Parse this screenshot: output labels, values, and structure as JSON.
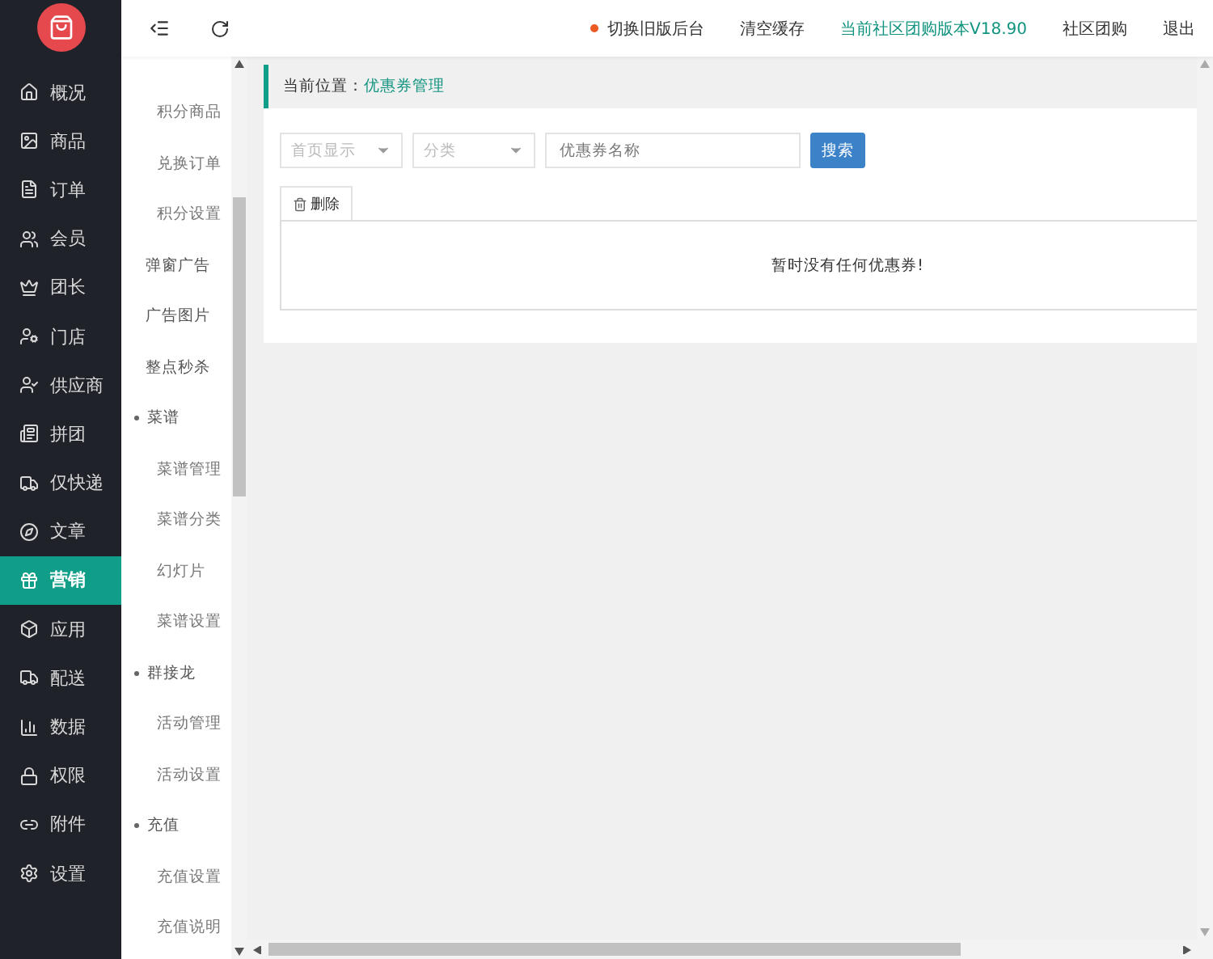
{
  "sidebar": {
    "items": [
      {
        "label": "概况",
        "selected": false
      },
      {
        "label": "商品",
        "selected": false
      },
      {
        "label": "订单",
        "selected": false
      },
      {
        "label": "会员",
        "selected": false
      },
      {
        "label": "团长",
        "selected": false
      },
      {
        "label": "门店",
        "selected": false
      },
      {
        "label": "供应商",
        "selected": false
      },
      {
        "label": "拼团",
        "selected": false
      },
      {
        "label": "仅快递",
        "selected": false
      },
      {
        "label": "文章",
        "selected": false
      },
      {
        "label": "营销",
        "selected": true
      },
      {
        "label": "应用",
        "selected": false
      },
      {
        "label": "配送",
        "selected": false
      },
      {
        "label": "数据",
        "selected": false
      },
      {
        "label": "权限",
        "selected": false
      },
      {
        "label": "附件",
        "selected": false
      },
      {
        "label": "设置",
        "selected": false
      }
    ]
  },
  "submenu": [
    {
      "children": [
        {
          "label": "积分商品"
        },
        {
          "label": "兑换订单"
        },
        {
          "label": "积分设置"
        }
      ]
    },
    {
      "label": "弹窗广告"
    },
    {
      "label": "广告图片"
    },
    {
      "label": "整点秒杀"
    },
    {
      "label": "菜谱",
      "expanded": true,
      "children": [
        {
          "label": "菜谱管理"
        },
        {
          "label": "菜谱分类"
        },
        {
          "label": "幻灯片"
        },
        {
          "label": "菜谱设置"
        }
      ]
    },
    {
      "label": "群接龙",
      "expanded": true,
      "children": [
        {
          "label": "活动管理"
        },
        {
          "label": "活动设置"
        }
      ]
    },
    {
      "label": "充值",
      "expanded": true,
      "children": [
        {
          "label": "充值设置"
        },
        {
          "label": "充值说明"
        }
      ]
    }
  ],
  "topbar": {
    "links": [
      {
        "label": "切换旧版后台",
        "kind": "dot"
      },
      {
        "label": "清空缓存",
        "kind": "plain"
      },
      {
        "label": "当前社区团购版本V18.90",
        "kind": "accent"
      },
      {
        "label": "社区团购",
        "kind": "plain"
      },
      {
        "label": "退出",
        "kind": "plain"
      }
    ]
  },
  "breadcrumb": {
    "label": "当前位置：",
    "current": "优惠券管理"
  },
  "filters": {
    "selects": [
      {
        "placeholder": "首页显示"
      },
      {
        "placeholder": "分类"
      }
    ],
    "search": {
      "placeholder": "优惠券名称"
    },
    "button": "搜索"
  },
  "toolbar": {
    "delete": "删除"
  },
  "table": {
    "empty": "暂时没有任何优惠券!"
  }
}
